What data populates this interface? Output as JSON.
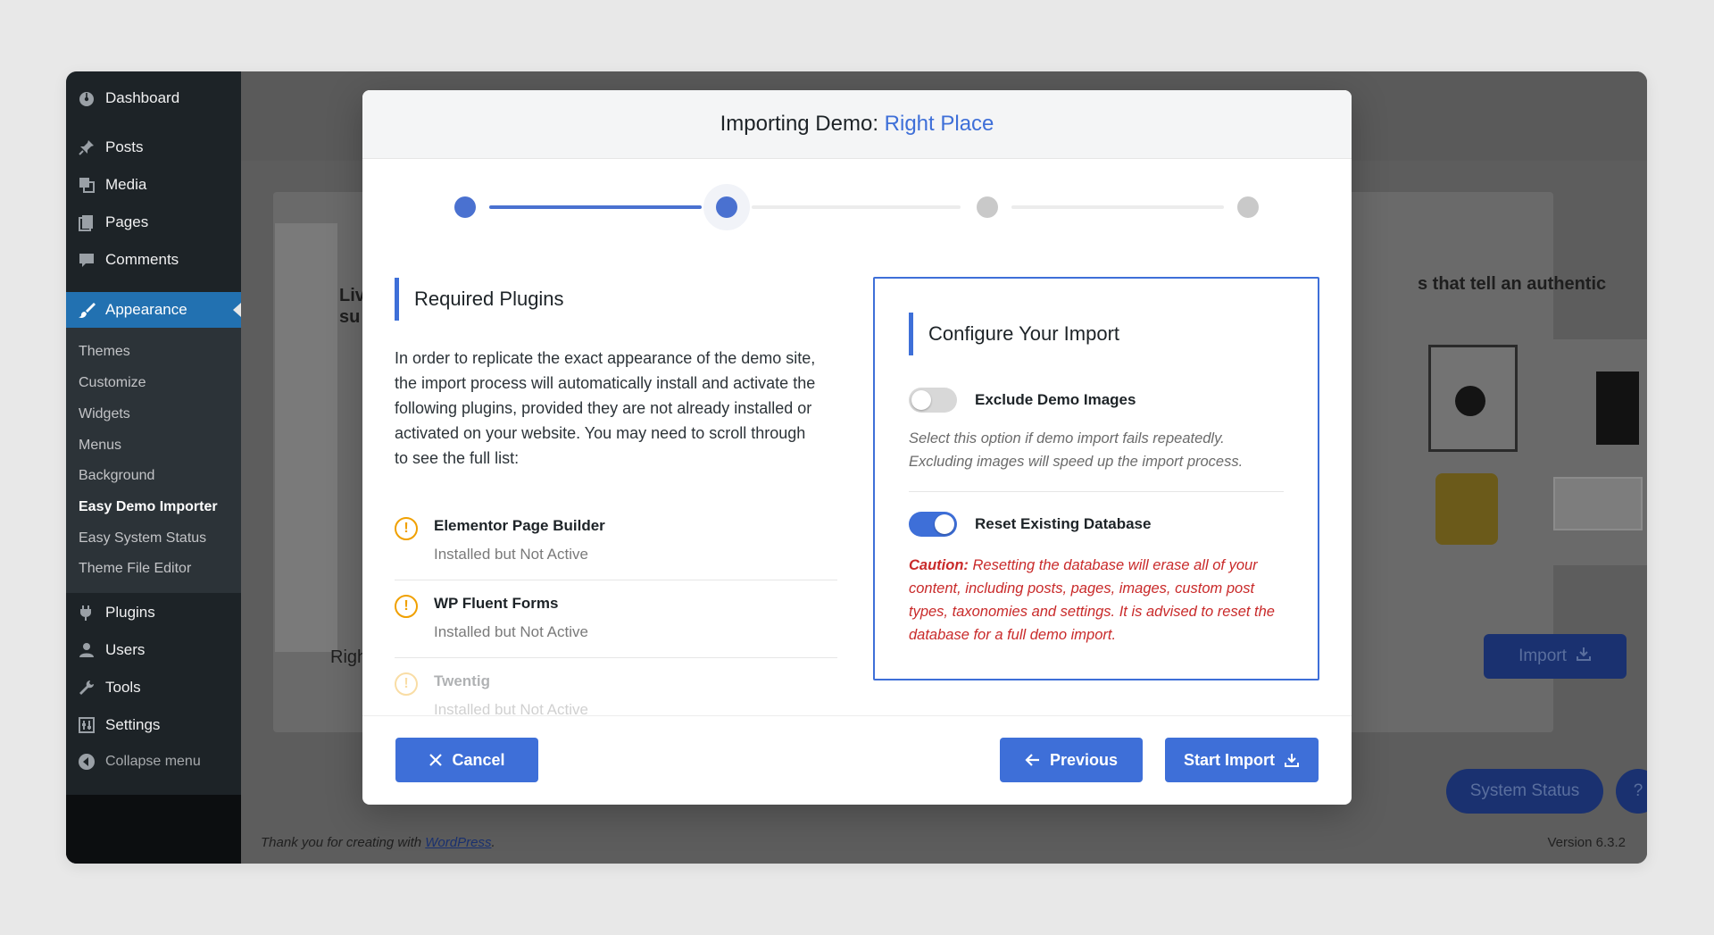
{
  "sidebar": {
    "items": [
      {
        "label": "Dashboard",
        "icon": "dashboard-icon"
      },
      {
        "label": "Posts",
        "icon": "pin-icon"
      },
      {
        "label": "Media",
        "icon": "media-icon"
      },
      {
        "label": "Pages",
        "icon": "pages-icon"
      },
      {
        "label": "Comments",
        "icon": "comment-icon"
      },
      {
        "label": "Appearance",
        "icon": "brush-icon"
      },
      {
        "label": "Plugins",
        "icon": "plugin-icon"
      },
      {
        "label": "Users",
        "icon": "user-icon"
      },
      {
        "label": "Tools",
        "icon": "wrench-icon"
      },
      {
        "label": "Settings",
        "icon": "settings-icon"
      }
    ],
    "submenu": [
      "Themes",
      "Customize",
      "Widgets",
      "Menus",
      "Background",
      "Easy Demo Importer",
      "Easy System Status",
      "Theme File Editor"
    ],
    "collapse_label": "Collapse menu"
  },
  "background": {
    "heading_snippet": "s that tell an authentic",
    "left_snippet_1": "Liv",
    "left_snippet_2": "su",
    "card_label_snippet": "Righ",
    "import_label": "Import",
    "system_status_label": "System Status",
    "help_label": "?",
    "footer_prefix": "Thank you for creating with ",
    "footer_link": "WordPress",
    "footer_suffix": ".",
    "version": "Version 6.3.2"
  },
  "modal": {
    "title_prefix": "Importing Demo:",
    "title_accent": "Right Place",
    "steps": {
      "total": 4,
      "current": 2
    },
    "required": {
      "title": "Required Plugins",
      "intro": "In order to replicate the exact appearance of the demo site, the import process will automatically install and activate the following plugins, provided they are not already installed or activated on your website. You may need to scroll through to see the full list:",
      "plugins": [
        {
          "name": "Elementor Page Builder",
          "status": "Installed but Not Active"
        },
        {
          "name": "WP Fluent Forms",
          "status": "Installed but Not Active"
        },
        {
          "name": "Twentig",
          "status": "Installed but Not Active"
        }
      ]
    },
    "configure": {
      "title": "Configure Your Import",
      "exclude_label": "Exclude Demo Images",
      "exclude_on": false,
      "exclude_hint": "Select this option if demo import fails repeatedly. Excluding images will speed up the import process.",
      "reset_label": "Reset Existing Database",
      "reset_on": true,
      "caution_label": "Caution:",
      "caution_text": " Resetting the database will erase all of your content, including posts, pages, images, custom post types, taxonomies and settings. It is advised to reset the database for a full demo import."
    },
    "footer": {
      "cancel_label": "Cancel",
      "previous_label": "Previous",
      "start_label": "Start Import"
    }
  },
  "colors": {
    "accent": "#3e6fd8",
    "sidebar": "#1d2327",
    "wp_active": "#2271b1",
    "caution": "#c92a2a",
    "warning": "#f0a000"
  }
}
